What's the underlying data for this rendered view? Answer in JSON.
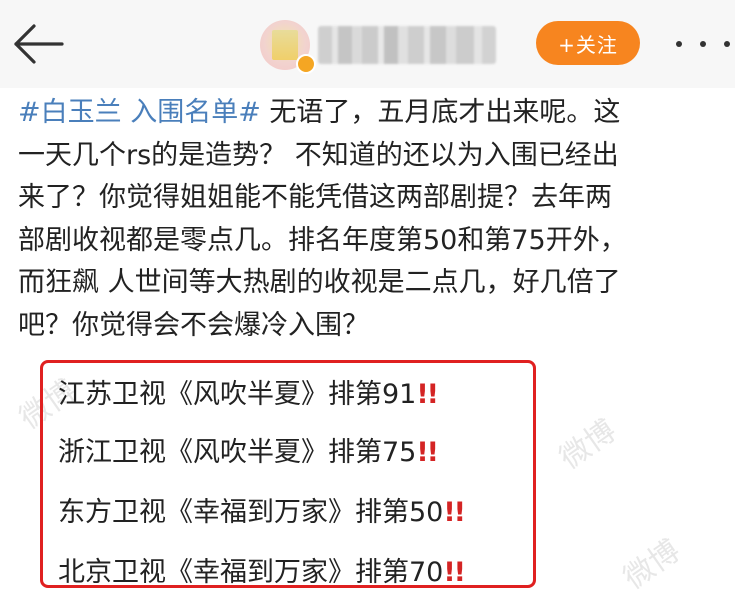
{
  "nav": {
    "back_icon": "arrow-left-icon",
    "follow_label": "+关注",
    "more_icon": "ellipsis-icon"
  },
  "post": {
    "hashtag": "#白玉兰 入围名单#",
    "lines": [
      " 无语了，五月底才出来呢。这",
      "一天几个rs的是造势？ 不知道的还以为入围已经出",
      "来了？你觉得姐姐能不能凭借这两部剧提？去年两",
      "部剧收视都是零点几。排名年度第50和第75开外，",
      "而狂飙 人世间等大热剧的收视是二点几，好几倍了",
      "吧？你觉得会不会爆冷入围？"
    ]
  },
  "rankings": [
    {
      "text": "江苏卫视《风吹半夏》排第91",
      "mark": "!!"
    },
    {
      "text": "浙江卫视《风吹半夏》排第75",
      "mark": "!!"
    },
    {
      "text": "东方卫视《幸福到万家》排第50",
      "mark": "!!"
    },
    {
      "text": "北京卫视《幸福到万家》排第70",
      "mark": "!!"
    }
  ],
  "watermarks": [
    "微博",
    "微博",
    "微博"
  ],
  "colors": {
    "accent": "#f7851f",
    "hashtag": "#4a7fbb",
    "highlight_border": "#e02020"
  }
}
